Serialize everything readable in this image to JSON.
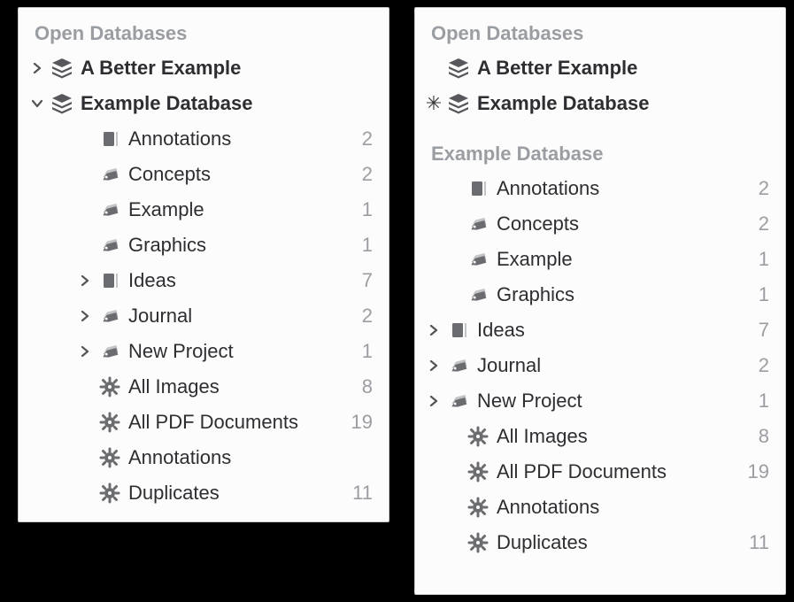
{
  "left": {
    "header": "Open Databases",
    "databases": [
      {
        "label": "A Better Example",
        "expanded": false
      },
      {
        "label": "Example Database",
        "expanded": true
      }
    ],
    "items": [
      {
        "icon": "box",
        "label": "Annotations",
        "count": "2",
        "expandable": false
      },
      {
        "icon": "tag",
        "label": "Concepts",
        "count": "2",
        "expandable": false
      },
      {
        "icon": "tag",
        "label": "Example",
        "count": "1",
        "expandable": false
      },
      {
        "icon": "tag",
        "label": "Graphics",
        "count": "1",
        "expandable": false
      },
      {
        "icon": "box",
        "label": "Ideas",
        "count": "7",
        "expandable": true
      },
      {
        "icon": "tag",
        "label": "Journal",
        "count": "2",
        "expandable": true
      },
      {
        "icon": "tag",
        "label": "New Project",
        "count": "1",
        "expandable": true
      },
      {
        "icon": "gear",
        "label": "All Images",
        "count": "8",
        "expandable": false
      },
      {
        "icon": "gear",
        "label": "All PDF Documents",
        "count": "19",
        "expandable": false
      },
      {
        "icon": "gear",
        "label": "Annotations",
        "count": "",
        "expandable": false
      },
      {
        "icon": "gear",
        "label": "Duplicates",
        "count": "11",
        "expandable": false
      }
    ]
  },
  "right": {
    "header1": "Open Databases",
    "databases": [
      {
        "label": "A Better Example",
        "marker": ""
      },
      {
        "label": "Example Database",
        "marker": "✳"
      }
    ],
    "header2": "Example Database",
    "items": [
      {
        "icon": "box",
        "label": "Annotations",
        "count": "2",
        "expandable": false
      },
      {
        "icon": "tag",
        "label": "Concepts",
        "count": "2",
        "expandable": false
      },
      {
        "icon": "tag",
        "label": "Example",
        "count": "1",
        "expandable": false
      },
      {
        "icon": "tag",
        "label": "Graphics",
        "count": "1",
        "expandable": false
      },
      {
        "icon": "box",
        "label": "Ideas",
        "count": "7",
        "expandable": true
      },
      {
        "icon": "tag",
        "label": "Journal",
        "count": "2",
        "expandable": true
      },
      {
        "icon": "tag",
        "label": "New Project",
        "count": "1",
        "expandable": true
      },
      {
        "icon": "gear",
        "label": "All Images",
        "count": "8",
        "expandable": false
      },
      {
        "icon": "gear",
        "label": "All PDF Documents",
        "count": "19",
        "expandable": false
      },
      {
        "icon": "gear",
        "label": "Annotations",
        "count": "",
        "expandable": false
      },
      {
        "icon": "gear",
        "label": "Duplicates",
        "count": "11",
        "expandable": false
      }
    ]
  }
}
